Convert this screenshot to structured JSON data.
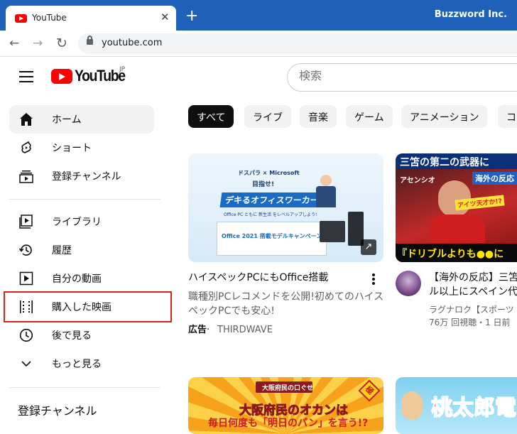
{
  "browser": {
    "tab_title": "YouTube",
    "tab_close": "✕",
    "new_tab": "+",
    "profile": "Buzzword Inc.",
    "back": "←",
    "forward": "→",
    "reload": "↻",
    "url": "youtube.com"
  },
  "header": {
    "logo_text": "YouTube",
    "region": "JP",
    "search_placeholder": "検索"
  },
  "sidebar": {
    "items": [
      {
        "label": "ホーム",
        "icon": "home-icon",
        "active": true
      },
      {
        "label": "ショート",
        "icon": "shorts-icon"
      },
      {
        "label": "登録チャンネル",
        "icon": "subscriptions-icon"
      },
      {
        "label": "ライブラリ",
        "icon": "library-icon"
      },
      {
        "label": "履歴",
        "icon": "history-icon"
      },
      {
        "label": "自分の動画",
        "icon": "your-videos-icon"
      },
      {
        "label": "購入した映画",
        "icon": "purchases-icon"
      },
      {
        "label": "後で見る",
        "icon": "watch-later-icon"
      },
      {
        "label": "もっと見る",
        "icon": "chevron-down-icon"
      }
    ],
    "section_title": "登録チャンネル"
  },
  "chips": [
    "すべて",
    "ライブ",
    "音楽",
    "ゲーム",
    "アニメーション",
    "コ"
  ],
  "videos": [
    {
      "thumb_brand": "ドスパラ × Microsoft",
      "thumb_headline": "目指せ!",
      "thumb_title": "デキるオフィスワーカー",
      "thumb_sub": "Office PC ともに 新生活 をレベルアップしよう!",
      "thumb_campaign": "Office 2021 搭載モデルキャンペーン",
      "title": "ハイスペックPCにもOffice搭載",
      "desc": "職種別PCレコメンドを公開!初めてのハイスペックPCでも安心!",
      "ad_label": "広告",
      "channel": "THIRDWAVE"
    },
    {
      "thumb_top": "三笘の第二の武器に",
      "thumb_name": "アセンシオ",
      "thumb_tag": "海外の反応",
      "thumb_bubble": "アイツ天才か!?",
      "thumb_bottom": "『ドリブルよりも●●に",
      "title_line1": "【海外の反応】三笘",
      "title_line2": "ル以上にスペイン代",
      "channel": "ラグナロク【スポーツ",
      "meta": "76万 回視聴・1 日前"
    },
    {
      "thumb_top": "大阪府民の口ぐせ",
      "thumb_stamp": "極",
      "thumb_title": "大阪府民のオカンは",
      "thumb_sub": "毎日何度も「明日のパン」を言う!?"
    },
    {
      "thumb_title": "桃太郎電"
    }
  ],
  "colors": {
    "titlebar": "#1f60b8",
    "youtube_red": "#ff0000",
    "highlight": "#e11e1e"
  }
}
